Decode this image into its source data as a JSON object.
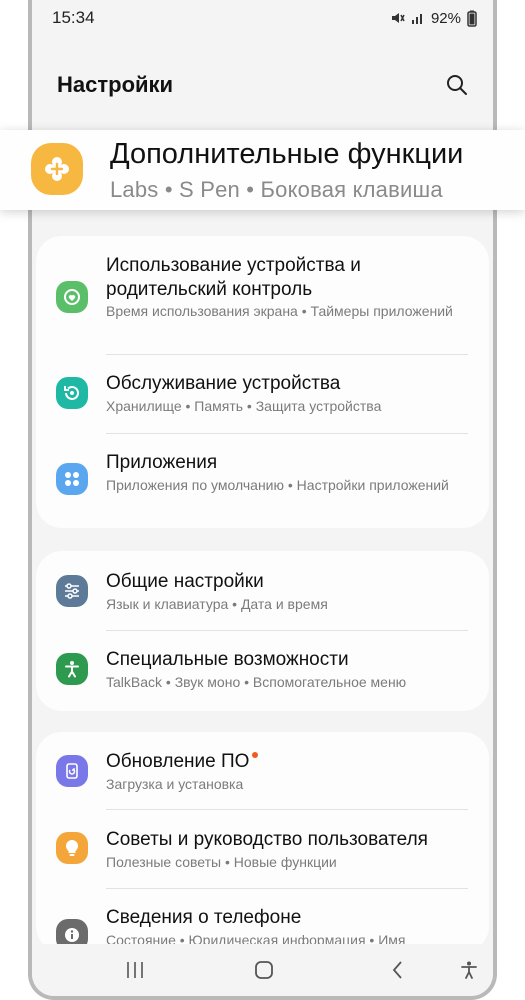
{
  "status_bar": {
    "time": "15:34",
    "battery": "92%",
    "icons": [
      "mute-icon",
      "signal-icon",
      "battery-icon"
    ]
  },
  "header": {
    "title": "Настройки",
    "search_icon": "search-icon"
  },
  "highlight": {
    "title": "Дополнительные функции",
    "subtitle": "Labs  •  S Pen  •  Боковая клавиша",
    "icon": "plus-gear-icon",
    "icon_color": "#f7b841"
  },
  "groups": [
    {
      "items": [
        {
          "title": "Использование устройства и родительский контроль",
          "subtitle": "Время использования экрана  •  Таймеры приложений",
          "icon": "digital-wellbeing-icon",
          "color": "#5bbf6a"
        },
        {
          "title": "Обслуживание устройства",
          "subtitle": "Хранилище  •  Память  •  Защита устройства",
          "icon": "device-care-icon",
          "color": "#1fb8a4"
        },
        {
          "title": "Приложения",
          "subtitle": "Приложения по умолчанию  •  Настройки приложений",
          "icon": "apps-icon",
          "color": "#5aa7f0"
        }
      ]
    },
    {
      "items": [
        {
          "title": "Общие настройки",
          "subtitle": "Язык и клавиатура  •  Дата и время",
          "icon": "sliders-icon",
          "color": "#5d7a99"
        },
        {
          "title": "Специальные возможности",
          "subtitle": "TalkBack  •  Звук моно  •  Вспомогательное меню",
          "icon": "accessibility-icon",
          "color": "#2e9a4f"
        }
      ]
    },
    {
      "items": [
        {
          "title": "Обновление ПО",
          "subtitle": "Загрузка и установка",
          "icon": "software-update-icon",
          "color": "#7a78e8",
          "badge": true
        },
        {
          "title": "Советы и руководство пользователя",
          "subtitle": "Полезные советы  •  Новые функции",
          "icon": "lightbulb-icon",
          "color": "#f5a63b"
        },
        {
          "title": "Сведения о телефоне",
          "subtitle": "Состояние  •  Юридическая информация  •  Имя",
          "icon": "info-icon",
          "color": "#6b6b6b"
        }
      ]
    }
  ],
  "nav_bar": {
    "icons": [
      "recent-apps-icon",
      "home-icon",
      "back-icon",
      "accessibility-shortcut-icon"
    ]
  }
}
